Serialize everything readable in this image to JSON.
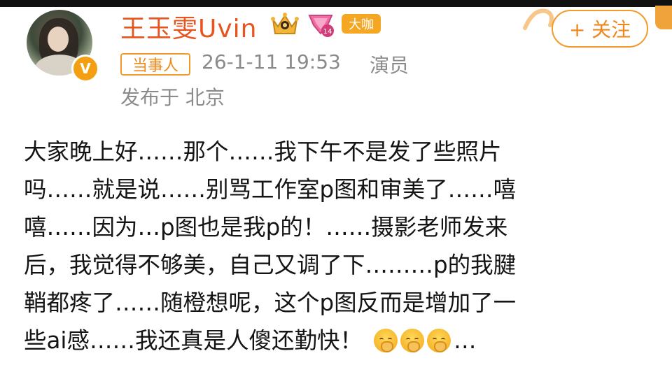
{
  "post": {
    "author": {
      "name": "王玉雯Uvin",
      "verified_mark": "V",
      "badges": {
        "crown": "crown-icon",
        "level": "lv-icon",
        "label": "大咖"
      }
    },
    "follow_button": "+ 关注",
    "tag": "当事人",
    "timestamp": "26-1-11 19:53",
    "role": "演员",
    "location": "发布于 北京",
    "text_lines": [
      "大家晚上好……那个……我下午不是发了些照片",
      "吗……就是说……别骂工作室p图和审美了……嘻",
      "嘻……因为…p图也是我p的！……摄影老师发来",
      "后，我觉得不够美，自己又调了下………p的我腱",
      "鞘都疼了……随橙想呢，这个p图反而是增加了一",
      "些ai感……我还真是人傻还勤快！"
    ],
    "trailing_ellipsis": "…",
    "emoji_count": 3,
    "colors": {
      "name": "#e8541e",
      "accent": "#f39b2a",
      "meta": "#8a8a8a",
      "text": "#141414"
    }
  }
}
